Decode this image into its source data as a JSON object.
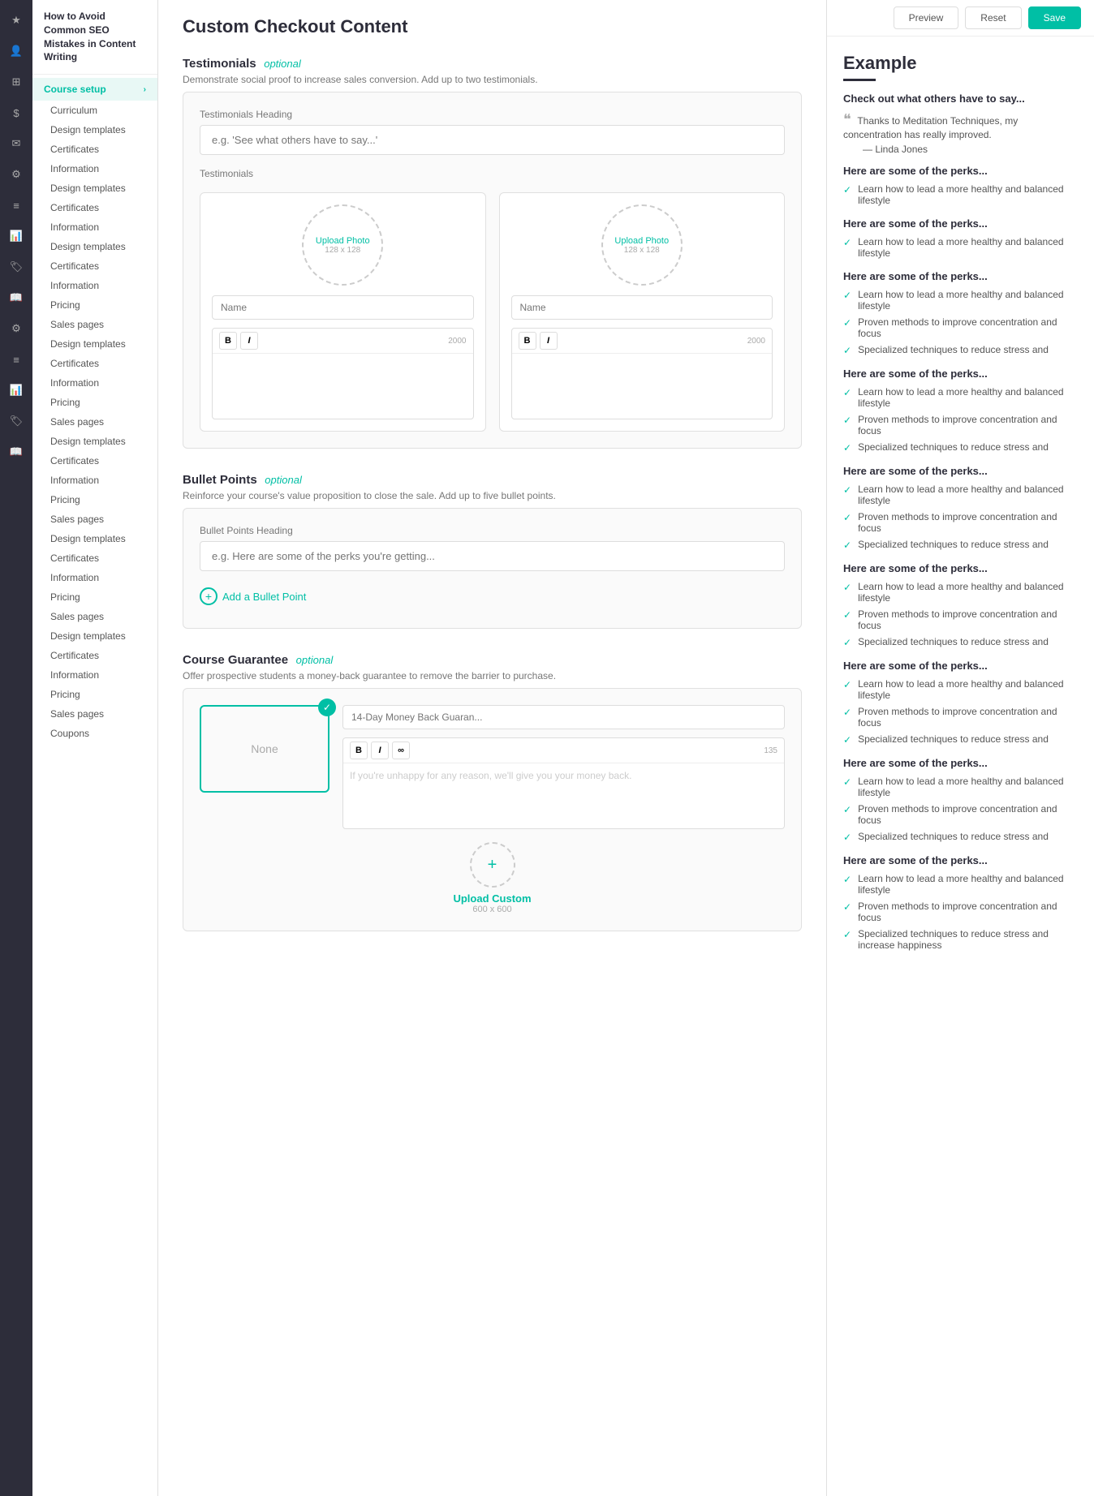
{
  "page": {
    "title": "Custom Checkout Content"
  },
  "sidebar": {
    "course_title": "How to Avoid Common SEO Mistakes in Content Writing",
    "menu_items": [
      {
        "label": "Course setup",
        "active": true,
        "has_chevron": true
      },
      {
        "label": "Curriculum"
      },
      {
        "label": "Design templates"
      },
      {
        "label": "Certificates"
      },
      {
        "label": "Information"
      },
      {
        "label": "Design templates"
      },
      {
        "label": "Certificates"
      },
      {
        "label": "Information"
      },
      {
        "label": "Design templates"
      },
      {
        "label": "Certificates"
      },
      {
        "label": "Information"
      },
      {
        "label": "Pricing"
      },
      {
        "label": "Sales pages"
      },
      {
        "label": "Design templates"
      },
      {
        "label": "Certificates"
      },
      {
        "label": "Information"
      },
      {
        "label": "Pricing"
      },
      {
        "label": "Sales pages"
      },
      {
        "label": "Design templates"
      },
      {
        "label": "Certificates"
      },
      {
        "label": "Information"
      },
      {
        "label": "Pricing"
      },
      {
        "label": "Sales pages"
      },
      {
        "label": "Design templates"
      },
      {
        "label": "Certificates"
      },
      {
        "label": "Information"
      },
      {
        "label": "Pricing"
      },
      {
        "label": "Sales pages"
      },
      {
        "label": "Design templates"
      },
      {
        "label": "Certificates"
      },
      {
        "label": "Information"
      },
      {
        "label": "Pricing"
      },
      {
        "label": "Sales pages"
      },
      {
        "label": "Coupons"
      }
    ]
  },
  "toolbar": {
    "preview_label": "Preview",
    "reset_label": "Reset",
    "save_label": "Save"
  },
  "testimonials_section": {
    "title": "Testimonials",
    "optional": "optional",
    "description": "Demonstrate social proof to increase sales conversion. Add up to two testimonials.",
    "heading_label": "Testimonials Heading",
    "heading_placeholder": "e.g. 'See what others have to say...'",
    "testimonials_label": "Testimonials",
    "cards": [
      {
        "upload_text": "Upload Photo",
        "size_text": "128 x 128",
        "name_placeholder": "Name",
        "char_count": "2000",
        "bold": "B",
        "italic": "I"
      },
      {
        "upload_text": "Upload Photo",
        "size_text": "128 x 128",
        "name_placeholder": "Name",
        "char_count": "2000",
        "bold": "B",
        "italic": "I"
      }
    ]
  },
  "bullet_points_section": {
    "title": "Bullet Points",
    "optional": "optional",
    "description": "Reinforce your course's value proposition to close the sale. Add up to five bullet points.",
    "heading_label": "Bullet Points Heading",
    "heading_placeholder": "e.g. Here are some of the perks you're getting...",
    "add_bullet_label": "Add a Bullet Point"
  },
  "guarantee_section": {
    "title": "Course Guarantee",
    "optional": "optional",
    "description": "Offer prospective students a money-back guarantee to remove the barrier to purchase.",
    "none_label": "None",
    "guarantee_title_placeholder": "14-Day Money Back Guaran...",
    "bold": "B",
    "italic": "I",
    "link": "∞",
    "char_count": "135",
    "body_placeholder": "If you're unhappy for any reason, we'll give you your money back."
  },
  "upload_custom_section": {
    "label": "Upload Custom",
    "size": "600 x 600"
  },
  "preview": {
    "title": "Example",
    "check_section_title": "Check out what others have to say...",
    "testimonial_text": "Thanks to Meditation Techniques, my concentration has really improved.",
    "attribution": "— Linda Jones",
    "perk_groups": [
      {
        "heading": "Here are some of the perks...",
        "perks": [
          "Learn how to lead a more healthy and balanced lifestyle"
        ]
      },
      {
        "heading": "Here are some of the perks...",
        "perks": [
          "Learn how to lead a more healthy and balanced lifestyle"
        ]
      },
      {
        "heading": "Here are some of the perks...",
        "perks": [
          "Learn how to lead a more healthy and balanced lifestyle",
          "Proven methods to improve concentration and focus",
          "Specialized techniques to reduce stress and"
        ]
      },
      {
        "heading": "Here are some of the perks...",
        "perks": [
          "Learn how to lead a more healthy and balanced lifestyle",
          "Proven methods to improve concentration and focus",
          "Specialized techniques to reduce stress and"
        ]
      },
      {
        "heading": "Here are some of the perks...",
        "perks": [
          "Learn how to lead a more healthy and balanced lifestyle",
          "Proven methods to improve concentration and focus",
          "Specialized techniques to reduce stress and"
        ]
      },
      {
        "heading": "Here are some of the perks...",
        "perks": [
          "Learn how to lead a more healthy and balanced lifestyle",
          "Proven methods to improve concentration and focus",
          "Specialized techniques to reduce stress and"
        ]
      },
      {
        "heading": "Here are some of the perks...",
        "perks": [
          "Learn how to lead a more healthy and balanced lifestyle",
          "Proven methods to improve concentration and focus",
          "Specialized techniques to reduce stress and"
        ]
      },
      {
        "heading": "Here are some of the perks...",
        "perks": [
          "Learn how to lead a more healthy and balanced lifestyle",
          "Proven methods to improve concentration and focus",
          "Specialized techniques to reduce stress and"
        ]
      },
      {
        "heading": "Here are some of the perks...",
        "perks": [
          "Learn how to lead a more healthy and balanced lifestyle",
          "Proven methods to improve concentration and focus",
          "Specialized techniques to reduce stress and increase happiness"
        ]
      }
    ]
  },
  "icons": {
    "star": "★",
    "user": "👤",
    "grid": "⊞",
    "dollar": "$",
    "mail": "✉",
    "gear": "⚙",
    "bars": "≡",
    "chart": "📊",
    "tag": "🏷",
    "book": "📖",
    "check": "✓",
    "plus": "+",
    "bold": "B",
    "italic": "I",
    "chevron_right": "›"
  }
}
